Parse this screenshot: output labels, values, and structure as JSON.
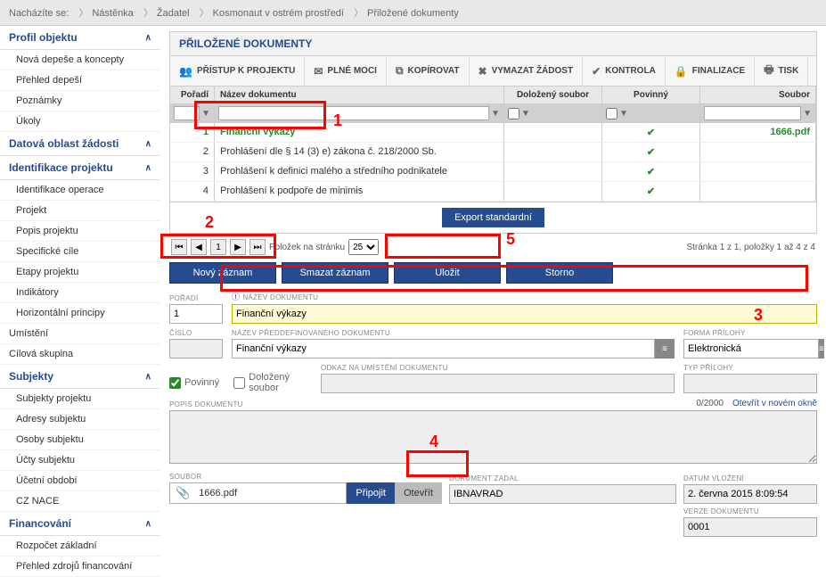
{
  "breadcrumb": {
    "label": "Nacházíte se:",
    "items": [
      "Nástěnka",
      "Žadatel",
      "Kosmonaut v ostrém prostředí",
      "Přiložené dokumenty"
    ]
  },
  "sidebar": {
    "sections": [
      {
        "title": "Profil objektu",
        "items": [
          "Nová depeše a koncepty",
          "Přehled depeší",
          "Poznámky",
          "Úkoly"
        ]
      },
      {
        "title": "Datová oblast žádosti",
        "items": []
      },
      {
        "title": "Identifikace projektu",
        "items": [
          "Identifikace operace",
          "Projekt",
          "Popis projektu",
          "Specifické cíle",
          "Etapy projektu",
          "Indikátory",
          "Horizontální principy"
        ]
      },
      {
        "title": null,
        "items": [
          "Umístění",
          "Cílová skupina"
        ]
      },
      {
        "title": "Subjekty",
        "items": [
          "Subjekty projektu",
          "Adresy subjektu",
          "Osoby subjektu",
          "Účty subjektu",
          "Účetní období",
          "CZ NACE"
        ]
      },
      {
        "title": "Financování",
        "items": [
          "Rozpočet základní",
          "Přehled zdrojů financování"
        ]
      }
    ]
  },
  "panel": {
    "title": "PŘILOŽENÉ DOKUMENTY"
  },
  "toolbar": {
    "pristup": "PŘÍSTUP K PROJEKTU",
    "plnemoci": "PLNÉ MOCI",
    "kopirovat": "KOPÍROVAT",
    "vymazat": "VYMAZAT ŽÁDOST",
    "kontrola": "KONTROLA",
    "finalizace": "FINALIZACE",
    "tisk": "TISK"
  },
  "grid": {
    "headers": {
      "poradi": "Pořadí",
      "nazev": "Název dokumentu",
      "dolozeny": "Doložený soubor",
      "povinny": "Povinný",
      "soubor": "Soubor"
    },
    "rows": [
      {
        "poradi": "1",
        "nazev": "Finanční výkazy",
        "dolozeny": "",
        "povinny": true,
        "soubor": "1666.pdf",
        "hl": true
      },
      {
        "poradi": "2",
        "nazev": "Prohlášení dle § 14 (3) e) zákona č. 218/2000 Sb.",
        "dolozeny": "",
        "povinny": true,
        "soubor": "",
        "hl": false
      },
      {
        "poradi": "3",
        "nazev": "Prohlášení k definici malého a středního podnikatele",
        "dolozeny": "",
        "povinny": true,
        "soubor": "",
        "hl": false
      },
      {
        "poradi": "4",
        "nazev": "Prohlášení k podpoře de minimis",
        "dolozeny": "",
        "povinny": true,
        "soubor": "",
        "hl": false
      }
    ],
    "export": "Export standardní",
    "pager": {
      "page": "1",
      "perpage_label": "Položek na stránku",
      "perpage": "25",
      "info": "Stránka 1 z 1, položky 1 až 4 z 4"
    }
  },
  "actions": {
    "novy": "Nový záznam",
    "smazat": "Smazat záznam",
    "ulozit": "Uložit",
    "storno": "Storno"
  },
  "form": {
    "poradi": {
      "label": "POŘADÍ",
      "value": "1"
    },
    "nazev": {
      "label": "NÁZEV DOKUMENTU",
      "value": "Finanční výkazy"
    },
    "cislo": {
      "label": "ČÍSLO",
      "value": ""
    },
    "preddef": {
      "label": "NÁZEV PŘEDDEFINOVANÉHO DOKUMENTU",
      "value": "Finanční výkazy"
    },
    "forma": {
      "label": "FORMA PŘÍLOHY",
      "value": "Elektronická"
    },
    "povinny": "Povinný",
    "dolozeny": "Doložený soubor",
    "odkaz": {
      "label": "ODKAZ NA UMÍSTĚNÍ DOKUMENTU",
      "value": ""
    },
    "typ": {
      "label": "TYP PŘÍLOHY",
      "value": ""
    },
    "popis": {
      "label": "POPIS DOKUMENTU",
      "value": "",
      "counter": "0/2000",
      "link": "Otevřít v novém okně"
    },
    "soubor": {
      "label": "SOUBOR",
      "value": "1666.pdf",
      "pripojit": "Připojit",
      "otevrit": "Otevřít"
    },
    "dokzadal": {
      "label": "DOKUMENT ZADAL",
      "value": "IBNAVRAD"
    },
    "datum": {
      "label": "DATUM VLOŽENÍ",
      "value": "2. června 2015 8:09:54"
    },
    "verze": {
      "label": "VERZE DOKUMENTU",
      "value": "0001"
    }
  },
  "annotations": {
    "n1": "1",
    "n2": "2",
    "n3": "3",
    "n4": "4",
    "n5": "5"
  }
}
